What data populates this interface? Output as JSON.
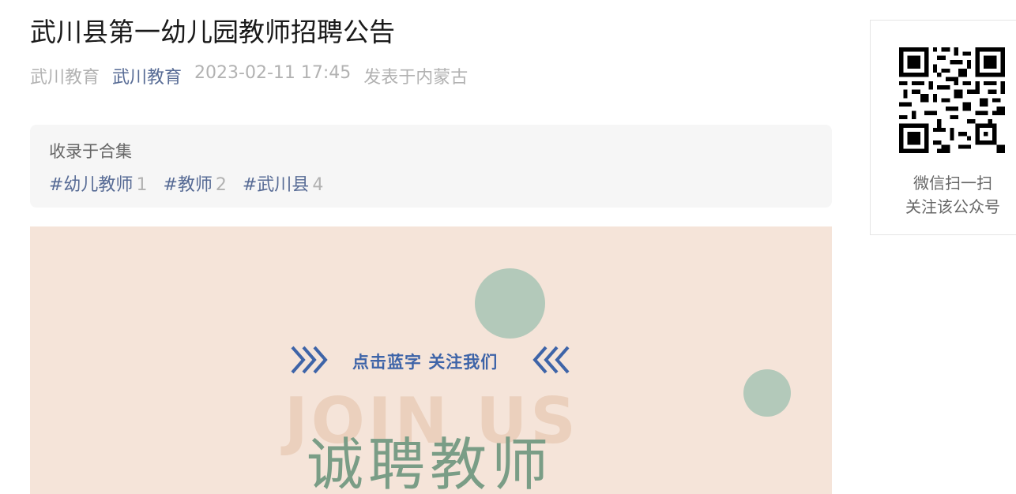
{
  "article": {
    "title": "武川县第一幼儿园教师招聘公告",
    "author": "武川教育",
    "account": "武川教育",
    "datetime": "2023-02-11 17:45",
    "location": "发表于内蒙古"
  },
  "collection": {
    "label": "收录于合集",
    "tags": [
      {
        "name": "#幼儿教师",
        "count": "1"
      },
      {
        "name": "#教师",
        "count": "2"
      },
      {
        "name": "#武川县",
        "count": "4"
      }
    ]
  },
  "banner": {
    "follow_text": "点击蓝字 关注我们",
    "join_text": "JOIN US",
    "hire_text": "诚聘教师",
    "colors": {
      "background": "#f5e4d9",
      "circle": "#b3c9ba",
      "follow": "#3e64a8",
      "join": "#ebd0bd",
      "hire": "#7a9d86"
    },
    "icons": [
      "chevrons-right-icon",
      "chevrons-left-icon"
    ]
  },
  "qr_panel": {
    "line1": "微信扫一扫",
    "line2": "关注该公众号",
    "icon": "qr-code-icon"
  },
  "colors": {
    "link": "#576b95",
    "muted": "#b2b2b2"
  }
}
